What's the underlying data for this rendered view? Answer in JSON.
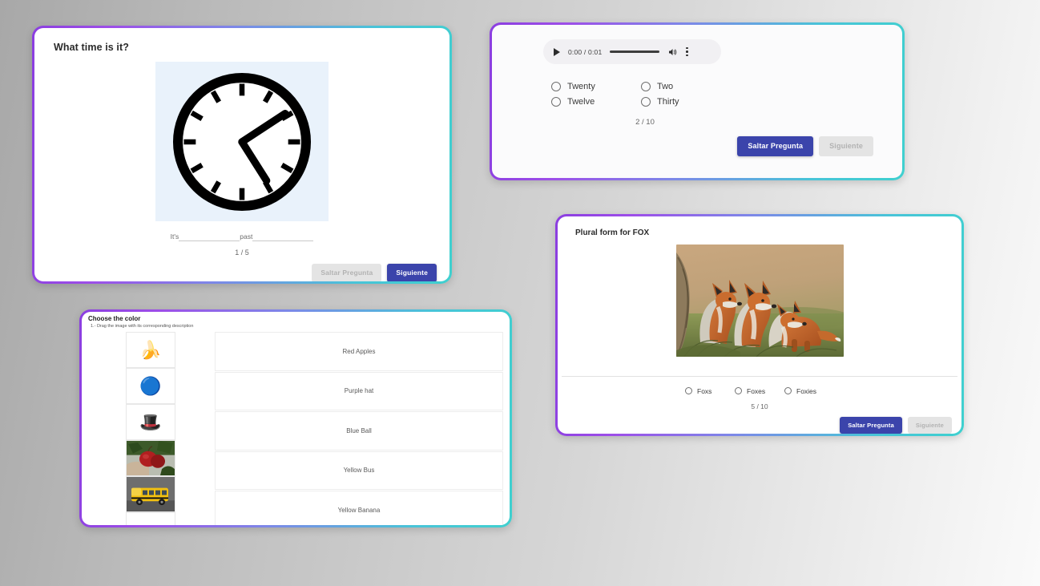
{
  "cards": {
    "clock": {
      "title": "What time is it?",
      "image_alt": "analog-clock",
      "clock_time": "4:10",
      "blank_prefix": "It's",
      "blank_middle": "past",
      "counter": "1 / 5",
      "skip_label": "Saltar Pregunta",
      "next_label": "Siguiente"
    },
    "audio": {
      "player": {
        "play_label": "play",
        "time": "0:00 / 0:01",
        "volume_label": "volume",
        "menu_label": "more-options"
      },
      "options": [
        "Twenty",
        "Two",
        "Twelve",
        "Thirty"
      ],
      "counter": "2 / 10",
      "skip_label": "Saltar Pregunta",
      "next_label": "Siguiente"
    },
    "match": {
      "title": "Choose the color",
      "subtitle": "1.- Drag the image with its corresponding description",
      "thumbs": [
        {
          "name": "bananas",
          "glyph": "🍌"
        },
        {
          "name": "blue-ball",
          "glyph": "🔵"
        },
        {
          "name": "purple-hat",
          "glyph": "🎩"
        },
        {
          "name": "red-apples",
          "glyph": ""
        },
        {
          "name": "yellow-bus",
          "glyph": ""
        },
        {
          "name": "empty-slot",
          "glyph": ""
        }
      ],
      "descriptions": [
        "Red Apples",
        "Purple hat",
        "Blue Ball",
        "Yellow Bus",
        "Yellow Banana"
      ]
    },
    "fox": {
      "title": "Plural form for FOX",
      "image_alt": "three-foxes-in-grass",
      "options": [
        "Foxs",
        "Foxes",
        "Foxies"
      ],
      "counter": "5 / 10",
      "skip_label": "Saltar Pregunta",
      "next_label": "Siguiente"
    }
  },
  "colors": {
    "primary_button": "#3b44ab",
    "disabled_button": "#e4e4e4",
    "border_start": "#8b3ee0",
    "border_end": "#3fd0cf",
    "clock_bg": "#e9f2fb"
  }
}
